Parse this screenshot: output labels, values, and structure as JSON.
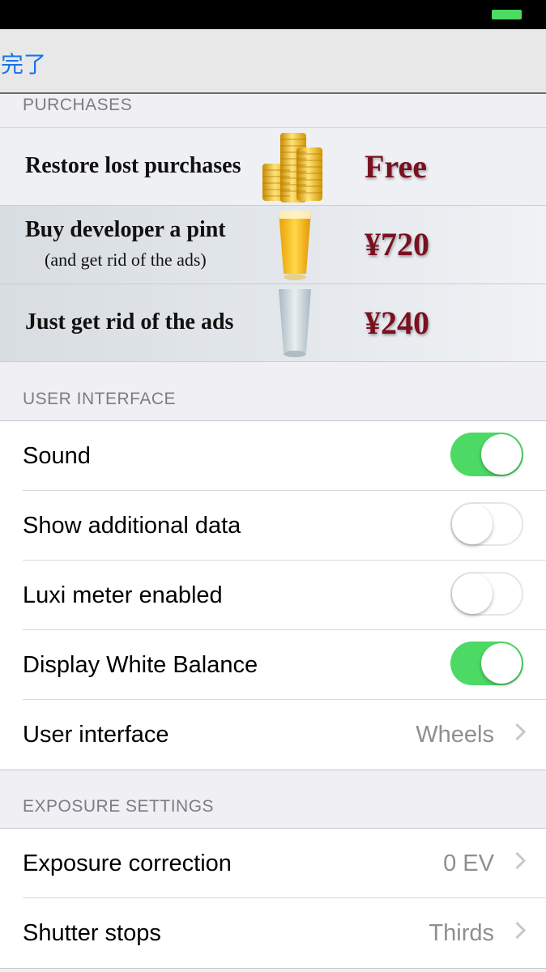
{
  "nav": {
    "done_label": "完了"
  },
  "purchases": {
    "header": "PURCHASES",
    "restore": {
      "title": "Restore lost purchases",
      "price": "Free",
      "icon": "coins-icon"
    },
    "pint": {
      "title": "Buy developer a pint",
      "subtitle": "(and get rid of the ads)",
      "price": "¥720",
      "icon": "beer-glass-icon"
    },
    "noads": {
      "title": "Just get rid of the ads",
      "price": "¥240",
      "icon": "empty-glass-icon"
    }
  },
  "user_interface": {
    "header": "USER INTERFACE",
    "sound": {
      "label": "Sound",
      "on": true
    },
    "additional": {
      "label": "Show additional data",
      "on": false
    },
    "luxi": {
      "label": "Luxi meter enabled",
      "on": false
    },
    "wb": {
      "label": "Display White Balance",
      "on": true
    },
    "ui": {
      "label": "User interface",
      "value": "Wheels"
    }
  },
  "exposure": {
    "header": "EXPOSURE SETTINGS",
    "correction": {
      "label": "Exposure correction",
      "value": "0 EV"
    },
    "shutter": {
      "label": "Shutter stops",
      "value": "Thirds"
    }
  },
  "colors": {
    "accent": "#1a73e8",
    "toggle_on": "#4cd964",
    "price": "#7a1020"
  }
}
